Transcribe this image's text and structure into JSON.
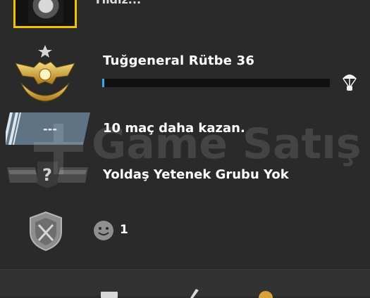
{
  "profile": {
    "name_partial": "Yildiz..."
  },
  "rank": {
    "title": "Tuğgeneral Rütbe 36",
    "progress": 0.01
  },
  "wins": {
    "placeholder": "---",
    "text": "10 maç daha kazan."
  },
  "wingman": {
    "text": "Yoldaş Yetenek Grubu Yok"
  },
  "commend": {
    "count": "1"
  },
  "watermark": {
    "text": "Game Satış"
  },
  "icons": {
    "rank": "eagle-rank-icon",
    "drop": "parachute-icon",
    "wins": "skill-plate-icon",
    "wingman": "wingman-unknown-icon",
    "shield": "shield-crest-icon",
    "commend": "smile-icon"
  },
  "colors": {
    "accent": "#f2c200",
    "progress": "#3aa7e6",
    "background": "#2a2a2b"
  }
}
